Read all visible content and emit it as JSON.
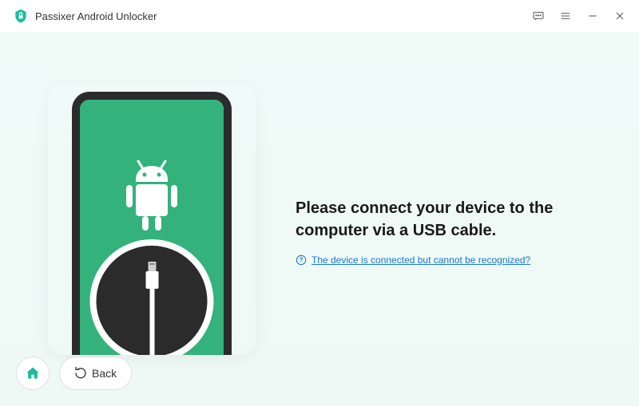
{
  "app": {
    "title": "Passixer Android Unlocker"
  },
  "main": {
    "heading": "Please connect your device to the computer via a USB cable.",
    "helpLink": "The device is connected but cannot be recognized?"
  },
  "bottom": {
    "backLabel": "Back"
  },
  "colors": {
    "accent": "#1abc9c",
    "link": "#1976d2",
    "androidGreen": "#33b27c"
  }
}
